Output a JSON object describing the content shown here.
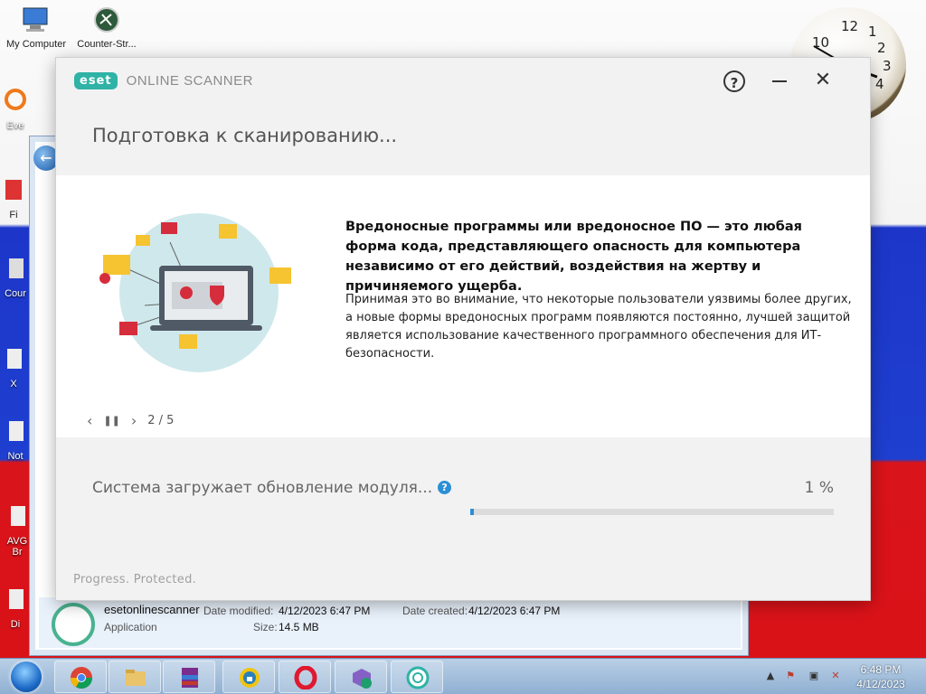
{
  "desktop": {
    "icons": [
      {
        "label": "My Computer"
      },
      {
        "label": "Counter-Str..."
      },
      {
        "label": "Eve"
      },
      {
        "label": "Fi"
      },
      {
        "label": "Cour"
      },
      {
        "label": "X"
      },
      {
        "label": "Not"
      },
      {
        "label": "AVG"
      },
      {
        "label": "Br"
      },
      {
        "label": "Di"
      }
    ],
    "clock_numbers": [
      "10",
      "12",
      "1",
      "2",
      "3",
      "4"
    ]
  },
  "explorer": {
    "file_name": "esetonlinescanner",
    "file_type": "Application",
    "date_modified_label": "Date modified:",
    "date_modified": "4/12/2023 6:47 PM",
    "date_created_label": "Date created:",
    "date_created": "4/12/2023 6:47 PM",
    "size_label": "Size:",
    "size": "14.5 MB"
  },
  "eset": {
    "logo": "eset",
    "product": "ONLINE SCANNER",
    "help_label": "?",
    "close_label": "✕",
    "title": "Подготовка к сканированию...",
    "headline": "Вредоносные программы или вредоносное ПО — это любая форма кода, представляющего опасность для компьютера независимо от его действий, воздействия на жертву и причиняемого ущерба.",
    "body": "Принимая это во внимание, что некоторые пользователи уязвимы более других, а новые формы вредоносных программ появляются постоянно, лучшей защитой является использование качественного программного обеспечения для ИТ-безопасности.",
    "pager": {
      "prev": "‹",
      "pause": "❚❚",
      "next": "›",
      "position": "2 / 5"
    },
    "status_text": "Система загружает обновление модуля...",
    "status_help": "?",
    "progress_percent": "1 %",
    "progress_value": 1,
    "tagline": "Progress. Protected."
  },
  "taskbar": {
    "apps": [
      "chrome",
      "file-explorer",
      "winrar",
      "lock-app",
      "opera",
      "visual-studio-installer",
      "eset-online-scanner"
    ],
    "time": "6:48 PM",
    "date": "4/12/2023"
  },
  "colors": {
    "eset_teal": "#2fb3a6",
    "progress_blue": "#2a8fd8",
    "flag_white": "#f4f4f4",
    "flag_blue": "#1e3fd0",
    "flag_red": "#d91218"
  }
}
